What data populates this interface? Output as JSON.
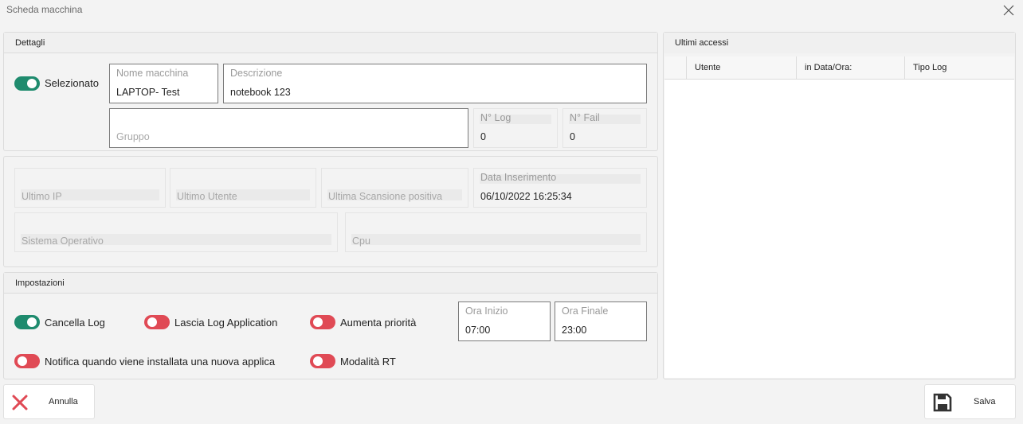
{
  "window": {
    "title": "Scheda macchina"
  },
  "dettagli": {
    "header": "Dettagli",
    "selezionato_label": "Selezionato",
    "nome_macchina": {
      "caption": "Nome macchina",
      "value": "LAPTOP- Test"
    },
    "descrizione": {
      "caption": "Descrizione",
      "value": "notebook 123"
    },
    "gruppo": {
      "placeholder": "Gruppo"
    },
    "n_log": {
      "caption": "N° Log",
      "value": "0"
    },
    "n_fail": {
      "caption": "N° Fail",
      "value": "0"
    }
  },
  "info": {
    "ultimo_ip": "Ultimo IP",
    "ultimo_utente": "Ultimo Utente",
    "ultima_scansione": "Ultima Scansione positiva",
    "data_inserimento": {
      "caption": "Data Inserimento",
      "value": "06/10/2022 16:25:34"
    },
    "sistema_operativo": "Sistema Operativo",
    "cpu": "Cpu"
  },
  "impostazioni": {
    "header": "Impostazioni",
    "cancella_log": "Cancella Log",
    "lascia_log": "Lascia Log Application",
    "aumenta_priorita": "Aumenta priorità",
    "notifica": "Notifica quando viene installata una nuova applica",
    "modalita_rt": "Modalità RT",
    "ora_inizio": {
      "caption": "Ora Inizio",
      "value": "07:00"
    },
    "ora_finale": {
      "caption": "Ora Finale",
      "value": "23:00"
    }
  },
  "ultimi_accessi": {
    "header": "Ultimi accessi",
    "columns": [
      "Utente",
      "in Data/Ora:",
      "Tipo Log"
    ]
  },
  "buttons": {
    "annulla": "Annulla",
    "salva": "Salva"
  },
  "colors": {
    "toggle_on": "#1f8b6e",
    "toggle_off": "#e04a55",
    "cancel_icon": "#e04a55"
  }
}
